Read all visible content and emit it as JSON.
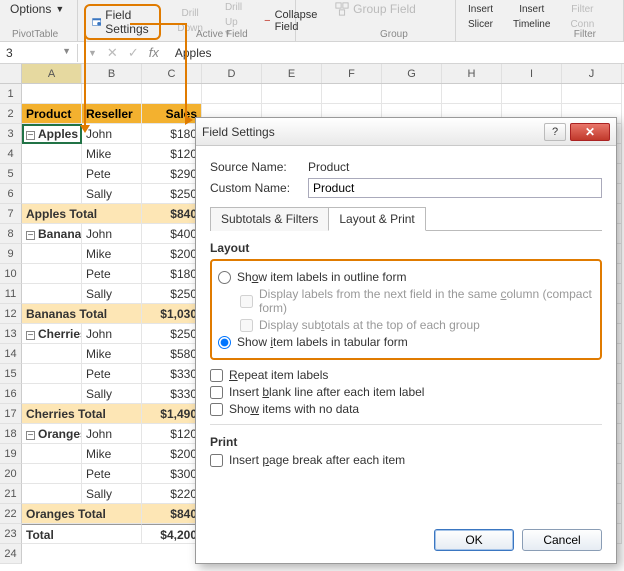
{
  "ribbon": {
    "options_label": "Options",
    "pivottable_label": "PivotTable",
    "field_settings_label": "Field Settings",
    "drill_down_label": "Drill Down",
    "drill_up_label": "Drill Up",
    "collapse_field_label": "Collapse Field",
    "active_field_label": "Active Field",
    "group_field_label": "Group Field",
    "group_label": "Group",
    "insert_slicer_label": "Insert Slicer",
    "insert_timeline_label": "Insert Timeline",
    "filter_conn_label": "Filter Conn",
    "filter_label": "Filter"
  },
  "namebox": "3",
  "formula_bar": "Apples",
  "columns": [
    "A",
    "B",
    "C",
    "D",
    "E",
    "F",
    "G",
    "H",
    "I",
    "J"
  ],
  "row_numbers": [
    "1",
    "2",
    "3",
    "4",
    "5",
    "6",
    "7",
    "8",
    "9",
    "10",
    "11",
    "12",
    "13",
    "14",
    "15",
    "16",
    "17",
    "18",
    "19",
    "20",
    "21",
    "22",
    "23",
    "24"
  ],
  "pivot": {
    "headers": [
      "Product",
      "Reseller",
      "Sales"
    ],
    "groups": [
      {
        "label": "Apples",
        "rows": [
          [
            "John",
            "$180"
          ],
          [
            "Mike",
            "$120"
          ],
          [
            "Pete",
            "$290"
          ],
          [
            "Sally",
            "$250"
          ]
        ],
        "total_label": "Apples Total",
        "total_value": "$840"
      },
      {
        "label": "Bananas",
        "rows": [
          [
            "John",
            "$400"
          ],
          [
            "Mike",
            "$200"
          ],
          [
            "Pete",
            "$180"
          ],
          [
            "Sally",
            "$250"
          ]
        ],
        "total_label": "Bananas Total",
        "total_value": "$1,030"
      },
      {
        "label": "Cherries",
        "rows": [
          [
            "John",
            "$250"
          ],
          [
            "Mike",
            "$580"
          ],
          [
            "Pete",
            "$330"
          ],
          [
            "Sally",
            "$330"
          ]
        ],
        "total_label": "Cherries Total",
        "total_value": "$1,490"
      },
      {
        "label": "Oranges",
        "rows": [
          [
            "John",
            "$120"
          ],
          [
            "Mike",
            "$200"
          ],
          [
            "Pete",
            "$300"
          ],
          [
            "Sally",
            "$220"
          ]
        ],
        "total_label": "Oranges Total",
        "total_value": "$840"
      }
    ],
    "grand_label": "Total",
    "grand_value": "$4,200"
  },
  "dialog": {
    "title": "Field Settings",
    "source_name_label": "Source Name:",
    "source_name_value": "Product",
    "custom_name_label": "Custom Name:",
    "custom_name_value": "Product",
    "tabs": {
      "subtotals": "Subtotals & Filters",
      "layout": "Layout & Print"
    },
    "layout_title": "Layout",
    "radio_outline": "Show item labels in outline form",
    "check_compact": "Display labels from the next field in the same column (compact form)",
    "check_subtop": "Display subtotals at the top of each group",
    "radio_tabular": "Show item labels in tabular form",
    "check_repeat": "Repeat item labels",
    "check_blank": "Insert blank line after each item label",
    "check_nodata": "Show items with no data",
    "print_title": "Print",
    "check_pagebreak": "Insert page break after each item",
    "ok": "OK",
    "cancel": "Cancel",
    "underline": {
      "outline": "o",
      "compact": "c",
      "subtop": "t",
      "tabular": "i",
      "repeat": "R",
      "blank": "b",
      "nodata": "w",
      "pagebreak": "p"
    }
  }
}
